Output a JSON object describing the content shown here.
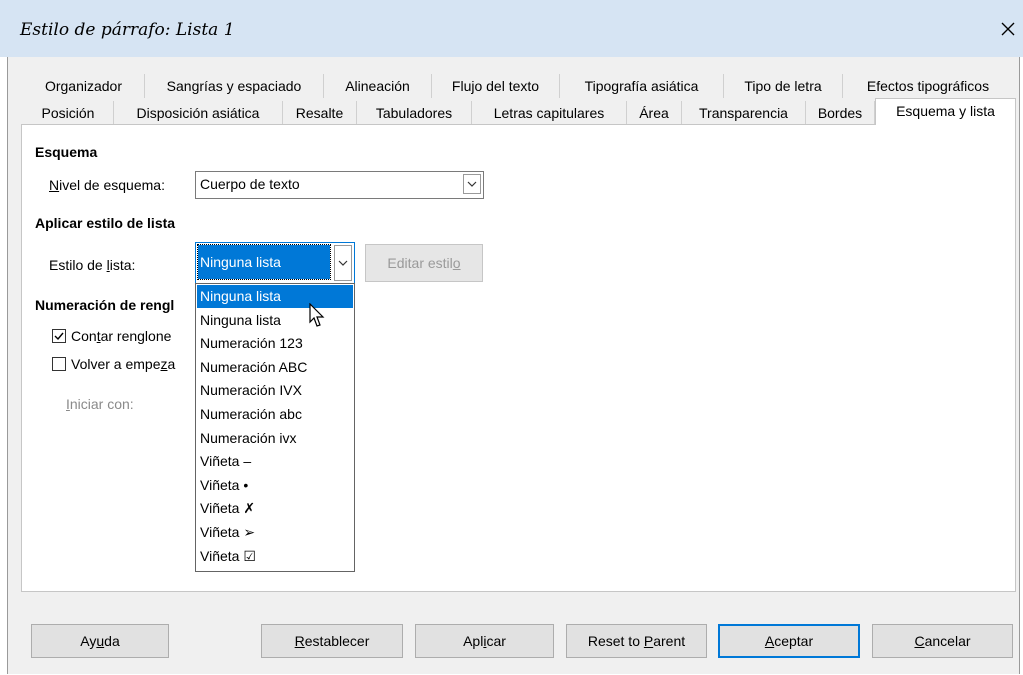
{
  "window": {
    "title": "Estilo de párrafo: Lista 1",
    "close_icon": "close-icon"
  },
  "tabs_row1": [
    "Organizador",
    "Sangrías y espaciado",
    "Alineación",
    "Flujo del texto",
    "Tipografía asiática",
    "Tipo de letra",
    "Efectos tipográficos"
  ],
  "tabs_row2": [
    "Posición",
    "Disposición asiática",
    "Resalte",
    "Tabuladores",
    "Letras capitulares",
    "Área",
    "Transparencia",
    "Bordes",
    "Esquema y lista"
  ],
  "active_tab": "Esquema y lista",
  "outline": {
    "heading": "Esquema",
    "level_label": "Nivel de esquema:",
    "level_value": "Cuerpo de texto"
  },
  "list_style": {
    "heading": "Aplicar estilo de lista",
    "label": "Estilo de lista:",
    "value": "Ninguna lista",
    "edit_button": "Editar estilo",
    "options": [
      "Ninguna lista",
      "Ninguna lista",
      "Numeración 123",
      "Numeración ABC",
      "Numeración IVX",
      "Numeración abc",
      "Numeración ivx",
      "Viñeta –",
      "Viñeta •",
      "Viñeta ✗",
      "Viñeta ➢",
      "Viñeta ☑"
    ],
    "highlighted_index": 0
  },
  "line_numbering": {
    "heading": "Numeración de rengl",
    "count_lines": {
      "label": "Contar renglone",
      "checked": true
    },
    "restart": {
      "label": "Volver a empeza",
      "checked": false
    },
    "start_with_label": "Iniciar con:"
  },
  "buttons": {
    "help": "Ayuda",
    "reset": "Restablecer",
    "apply": "Aplicar",
    "reset_parent": "Reset to Parent",
    "ok": "Aceptar",
    "cancel": "Cancelar"
  },
  "colors": {
    "selection": "#0078d7",
    "title_bar": "#d6e4f3",
    "dialog_bg": "#f0f0f0"
  }
}
